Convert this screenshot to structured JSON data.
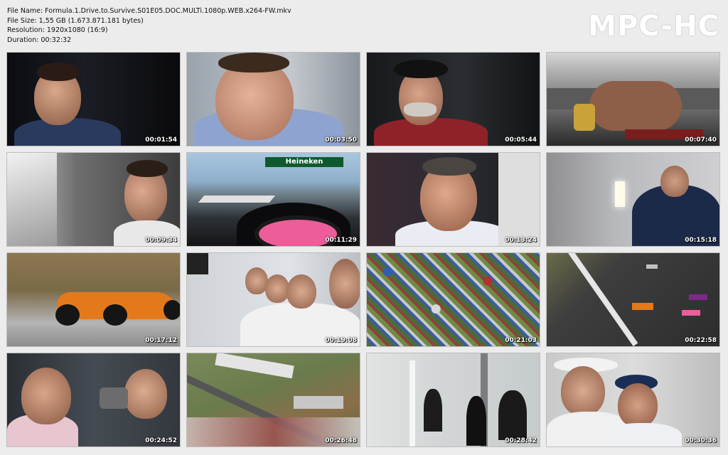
{
  "info": {
    "file_name": "File Name: Formula.1.Drive.to.Survive.S01E05.DOC.MULTi.1080p.WEB.x264-FW.mkv",
    "file_size": "File Size: 1,55 GB (1.673.871.181 bytes)",
    "resolution": "Resolution: 1920x1080 (16:9)",
    "duration": "Duration: 00:32:32"
  },
  "logo": "MPC-HC",
  "thumbnails": [
    {
      "time": "00:01:54",
      "scene": "man-dark-background"
    },
    {
      "time": "00:03:50",
      "scene": "man-closeup-blue-shirt"
    },
    {
      "time": "00:05:44",
      "scene": "man-cap-red-sweater"
    },
    {
      "time": "00:07:40",
      "scene": "hands-gold-watch"
    },
    {
      "time": "00:09:34",
      "scene": "driver-side-profile"
    },
    {
      "time": "00:11:29",
      "scene": "onboard-camera-heineken"
    },
    {
      "time": "00:13:24",
      "scene": "man-interview-logitech"
    },
    {
      "time": "00:15:18",
      "scene": "man-back-racing-point-shirt"
    },
    {
      "time": "00:17:12",
      "scene": "orange-f1-car"
    },
    {
      "time": "00:19:08",
      "scene": "pit-wall-engineers"
    },
    {
      "time": "00:21:03",
      "scene": "campsite-aerial"
    },
    {
      "time": "00:22:58",
      "scene": "race-start-aerial"
    },
    {
      "time": "00:24:52",
      "scene": "garage-crew-cheering"
    },
    {
      "time": "00:26:48",
      "scene": "circuit-aerial"
    },
    {
      "time": "00:28:42",
      "scene": "team-room"
    },
    {
      "time": "00:30:36",
      "scene": "drivers-caps"
    }
  ]
}
